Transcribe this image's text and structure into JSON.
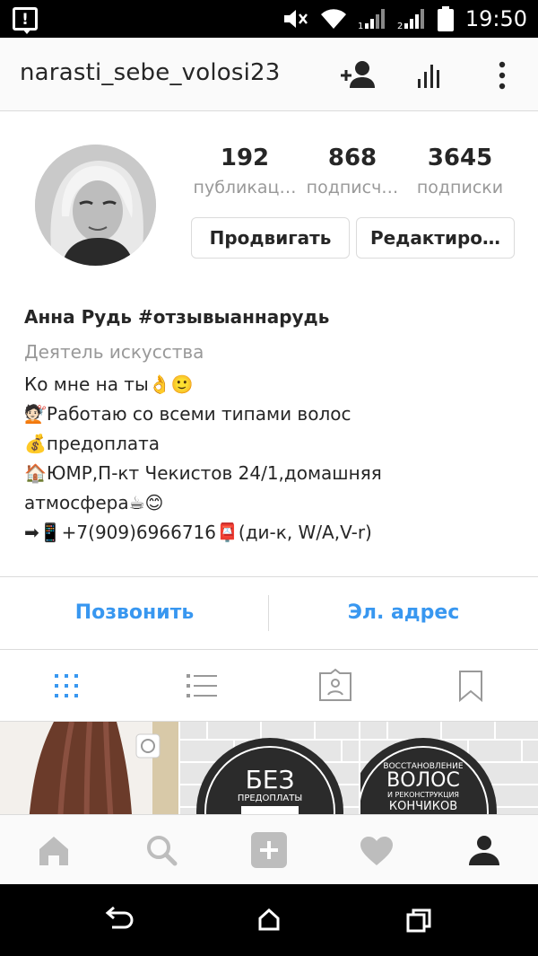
{
  "status_bar": {
    "time": "19:50",
    "icons": [
      "notification-warning-icon",
      "mute-icon",
      "wifi-icon",
      "signal-sim1-icon",
      "signal-sim2-icon",
      "battery-icon"
    ]
  },
  "header": {
    "username": "narasti_sebe_volosi23",
    "icons": [
      "add-person-icon",
      "insights-icon",
      "more-vertical-icon"
    ]
  },
  "profile": {
    "stats": [
      {
        "count": "192",
        "label": "публикац…"
      },
      {
        "count": "868",
        "label": "подписч…"
      },
      {
        "count": "3645",
        "label": "подписки"
      }
    ],
    "promote_label": "Продвигать",
    "edit_label": "Редактиро…"
  },
  "bio": {
    "name": "Анна Рудь #отзывыаннарудь",
    "category": "Деятель искусства",
    "lines": [
      "Ко мне на ты👌🙂",
      "💇🏻Работаю со всеми типами волос",
      "💰предоплата",
      "🏠ЮМР,П-кт Чекистов 24/1,домашняя",
      "атмосфера☕😊",
      "➡📱+7(909)6966716📮(ди-к, W/A,V-r)"
    ]
  },
  "contacts": {
    "call_label": "Позвонить",
    "email_label": "Эл. адрес"
  },
  "tabs": [
    "grid-icon",
    "list-icon",
    "tagged-icon",
    "bookmark-icon"
  ],
  "grid": {
    "tile2_text_big": "БЕЗ",
    "tile2_text_small": "ПРЕДОПЛАТЫ",
    "tile3_line1": "ВОССТАНОВЛЕНИЕ",
    "tile3_line2": "ВОЛОС",
    "tile3_line3": "И РЕКОНСТРУКЦИЯ",
    "tile3_line4": "КОНЧИКОВ"
  },
  "bottom_nav": [
    "home-icon",
    "search-icon",
    "add-post-icon",
    "heart-icon",
    "profile-icon"
  ],
  "system_nav": [
    "back-icon",
    "home-button-icon",
    "recents-icon"
  ],
  "colors": {
    "link": "#3897f0",
    "muted": "#999999",
    "text": "#262626"
  }
}
